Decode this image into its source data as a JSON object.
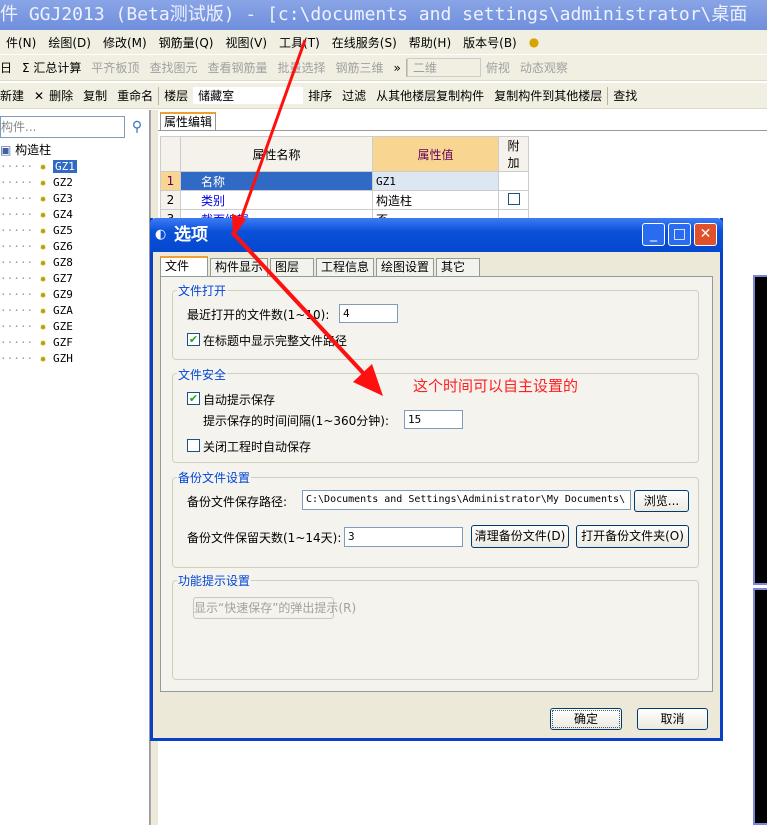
{
  "window": {
    "title": "件 GGJ2013 (Beta测试版) - [c:\\documents and settings\\administrator\\桌面"
  },
  "menu": [
    "件(N)",
    "绘图(D)",
    "修改(M)",
    "钢筋量(Q)",
    "视图(V)",
    "工具(T)",
    "在线服务(S)",
    "帮助(H)",
    "版本号(B)"
  ],
  "toolbar1": {
    "items": [
      "日",
      "Σ 汇总计算",
      "平齐板顶",
      "查找图元",
      "查看钢筋量",
      "批量选择",
      "钢筋三维",
      "»",
      "二维",
      "俯视",
      "动态观察"
    ]
  },
  "toolbar2": {
    "items": [
      "新建",
      "删除",
      "复制",
      "重命名",
      "楼层",
      "储藏室",
      "排序",
      "过滤",
      "从其他楼层复制构件",
      "复制构件到其他楼层",
      "查找"
    ]
  },
  "left": {
    "search_placeholder": "构件...",
    "root": "构造柱",
    "items": [
      "GZ1",
      "GZ2",
      "GZ3",
      "GZ4",
      "GZ5",
      "GZ6",
      "GZ8",
      "GZ7",
      "GZ9",
      "GZA",
      "GZE",
      "GZF",
      "GZH"
    ],
    "selected": "GZ1"
  },
  "props": {
    "tab": "属性编辑",
    "headers": [
      "属性名称",
      "属性值",
      "附加"
    ],
    "rows": [
      {
        "n": "1",
        "name": "名称",
        "value": "GZ1"
      },
      {
        "n": "2",
        "name": "类别",
        "value": "构造柱"
      },
      {
        "n": "3",
        "name": "截面编辑",
        "value": "否"
      }
    ]
  },
  "dialog": {
    "title": "选项",
    "tabs": [
      "文件",
      "构件显示",
      "图层",
      "工程信息",
      "绘图设置",
      "其它"
    ],
    "file_open": {
      "legend": "文件打开",
      "recent_label": "最近打开的文件数(1~10):",
      "recent_value": "4",
      "fullpath_label": "在标题中显示完整文件路径",
      "fullpath_checked": true
    },
    "file_safety": {
      "legend": "文件安全",
      "autoprompt_label": "自动提示保存",
      "autoprompt_checked": true,
      "interval_label": "提示保存的时间间隔(1~360分钟):",
      "interval_value": "15",
      "autosave_label": "关闭工程时自动保存",
      "autosave_checked": false
    },
    "backup": {
      "legend": "备份文件设置",
      "path_label": "备份文件保存路径:",
      "path_value": "C:\\Documents and Settings\\Administrator\\My Documents\\",
      "browse": "浏览...",
      "days_label": "备份文件保留天数(1~14天):",
      "days_value": "3",
      "clean": "清理备份文件(D)",
      "open": "打开备份文件夹(O)"
    },
    "tips": {
      "legend": "功能提示设置",
      "button": "显示“快速保存”的弹出提示(R)"
    },
    "ok": "确定",
    "cancel": "取消"
  },
  "annotation": "这个时间可以自主设置的",
  "colors": {
    "annotation": "#ff2020",
    "dialog_title": "#0a50d8",
    "legend": "#0046d5"
  }
}
